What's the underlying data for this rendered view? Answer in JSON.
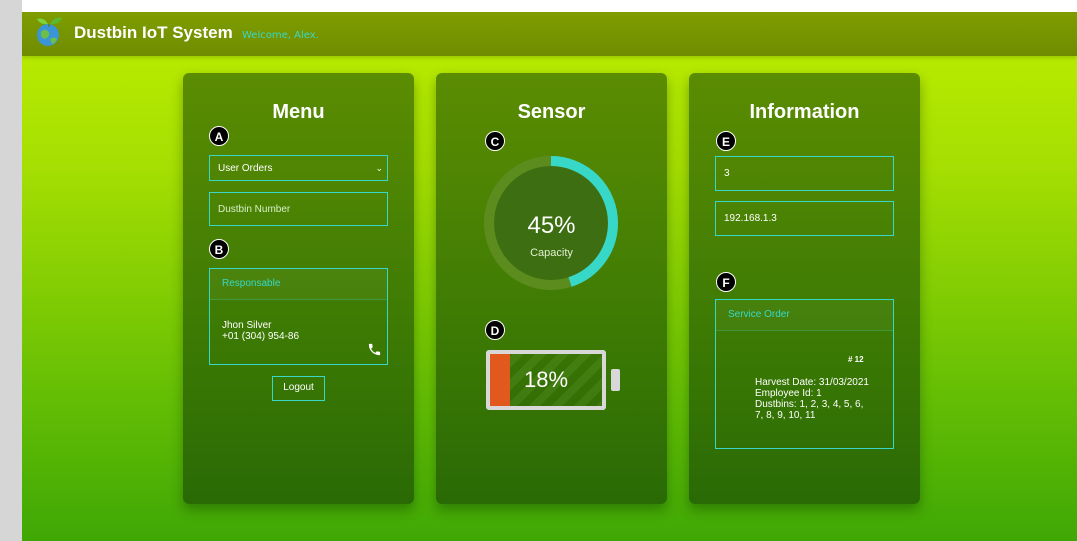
{
  "app": {
    "title": "Dustbin IoT System",
    "welcome": "Welcome, Alex."
  },
  "menu": {
    "title": "Menu",
    "marker_a": "A",
    "marker_b": "B",
    "select_value": "User Orders",
    "dustbin_placeholder": "Dustbin Number",
    "responsable_header": "Responsable",
    "contact_name": "Jhon Silver",
    "contact_phone": "+01 (304) 954-86",
    "logout_label": "Logout"
  },
  "sensor": {
    "title": "Sensor",
    "marker_c": "C",
    "marker_d": "D",
    "capacity_label": "Capacity",
    "capacity_text": "45%",
    "capacity_fraction": 0.45,
    "battery_text": "18%",
    "battery_fraction": 0.18
  },
  "information": {
    "title": "Information",
    "marker_e": "E",
    "marker_f": "F",
    "field_1_value": "3",
    "field_2_value": "192.168.1.3",
    "service_header": "Service Order",
    "order_number": "# 12",
    "harvest_date": "Harvest Date: 31/03/2021",
    "employee_id": "Employee Id: 1",
    "dustbins_line1": "Dustbins: 1, 2, 3, 4, 5, 6,",
    "dustbins_line2": "7, 8, 9, 10, 11"
  },
  "colors": {
    "accent": "#38d8c8",
    "battery_fill": "#e2591e",
    "gauge_track": "#5d8c1e"
  },
  "icons": {
    "logo": "earth-with-leaves-icon",
    "phone": "phone-icon",
    "dropdown": "chevron-down-icon"
  }
}
